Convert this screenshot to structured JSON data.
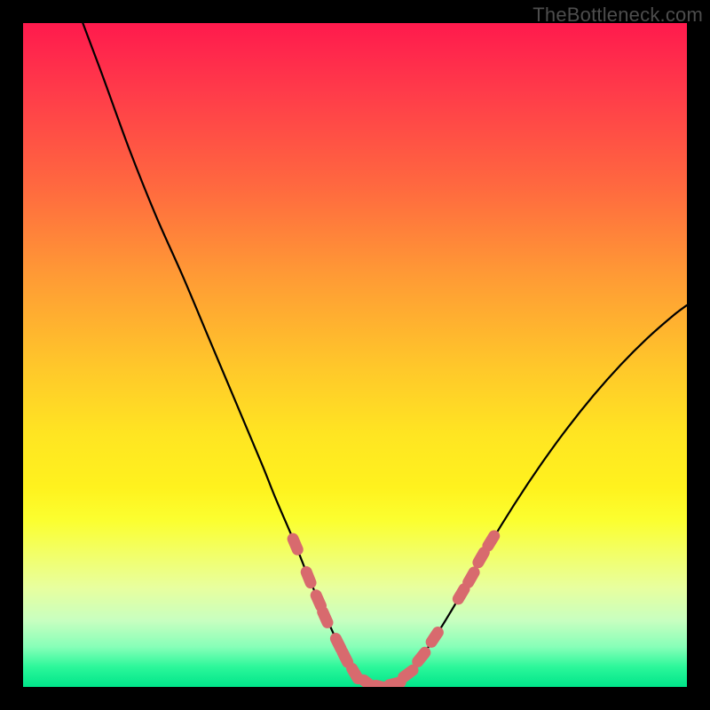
{
  "watermark": "TheBottleneck.com",
  "colors": {
    "frame": "#000000",
    "curve": "#000000",
    "marker_fill": "#d86a6e",
    "marker_stroke": "#c4585c"
  },
  "chart_data": {
    "type": "line",
    "title": "",
    "xlabel": "",
    "ylabel": "",
    "xlim": [
      0,
      100
    ],
    "ylim": [
      0,
      100
    ],
    "grid": false,
    "annotations": [
      "TheBottleneck.com"
    ],
    "series": [
      {
        "name": "curve",
        "x": [
          9,
          12,
          16,
          20,
          24,
          28,
          32,
          36,
          38,
          41,
          43,
          45,
          47,
          48.5,
          50,
          52,
          54,
          56,
          58,
          60,
          63,
          66,
          70,
          74,
          78,
          82,
          86,
          90,
          94,
          98,
          100
        ],
        "y": [
          100,
          92,
          81,
          71,
          62,
          52.5,
          43,
          33.5,
          28.5,
          21.5,
          16.5,
          12,
          7.5,
          4.5,
          2,
          0.5,
          0,
          0.5,
          2,
          4.5,
          9,
          14,
          21,
          27.5,
          33.5,
          39,
          44,
          48.5,
          52.5,
          56,
          57.5
        ]
      }
    ],
    "markers": {
      "name": "highlighted-points",
      "points": [
        {
          "x": 41,
          "y": 21.5
        },
        {
          "x": 43,
          "y": 16.5
        },
        {
          "x": 44.5,
          "y": 13
        },
        {
          "x": 45.5,
          "y": 10.5
        },
        {
          "x": 47.5,
          "y": 6.5
        },
        {
          "x": 48.5,
          "y": 4.5
        },
        {
          "x": 50,
          "y": 2
        },
        {
          "x": 52,
          "y": 0.5
        },
        {
          "x": 54,
          "y": 0
        },
        {
          "x": 56,
          "y": 0.5
        },
        {
          "x": 58,
          "y": 2
        },
        {
          "x": 60,
          "y": 4.5
        },
        {
          "x": 62,
          "y": 7.5
        },
        {
          "x": 66,
          "y": 14
        },
        {
          "x": 67.5,
          "y": 16.5
        },
        {
          "x": 69,
          "y": 19.5
        },
        {
          "x": 70.5,
          "y": 22
        }
      ]
    }
  }
}
